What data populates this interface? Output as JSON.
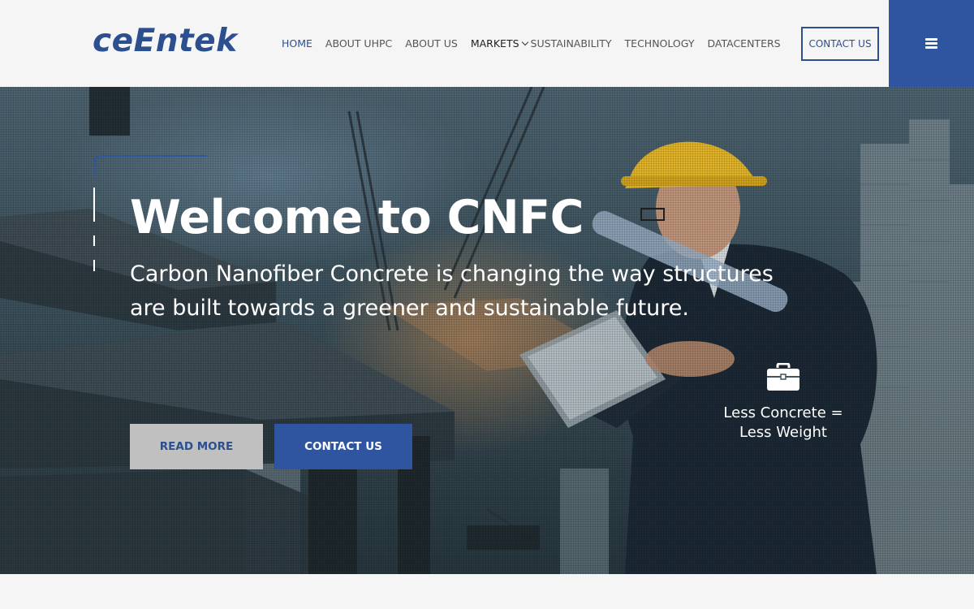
{
  "header": {
    "logo": "ceEntek",
    "nav": [
      {
        "label": "HOME",
        "active": true
      },
      {
        "label": "ABOUT UHPC"
      },
      {
        "label": "ABOUT US"
      },
      {
        "label": "MARKETS",
        "has_dropdown": true
      },
      {
        "label": "SUSTAINABILITY"
      },
      {
        "label": "TECHNOLOGY"
      },
      {
        "label": "DATACENTERS"
      }
    ],
    "contact_label": "CONTACT US",
    "menu_icon": "hamburger-icon"
  },
  "hero": {
    "title": "Welcome to CNFC",
    "subtitle": "Carbon Nanofiber Concrete is changing the way structures are built towards a greener and sustainable future.",
    "read_more": "READ MORE",
    "contact_us": "CONTACT US",
    "feature": {
      "icon": "briefcase-icon",
      "line1": "Less Concrete =",
      "line2": "Less Weight"
    }
  },
  "colors": {
    "brand_blue": "#2f55a0",
    "logo_blue": "#2c4f8f",
    "button_gray": "#c0c0c0"
  }
}
